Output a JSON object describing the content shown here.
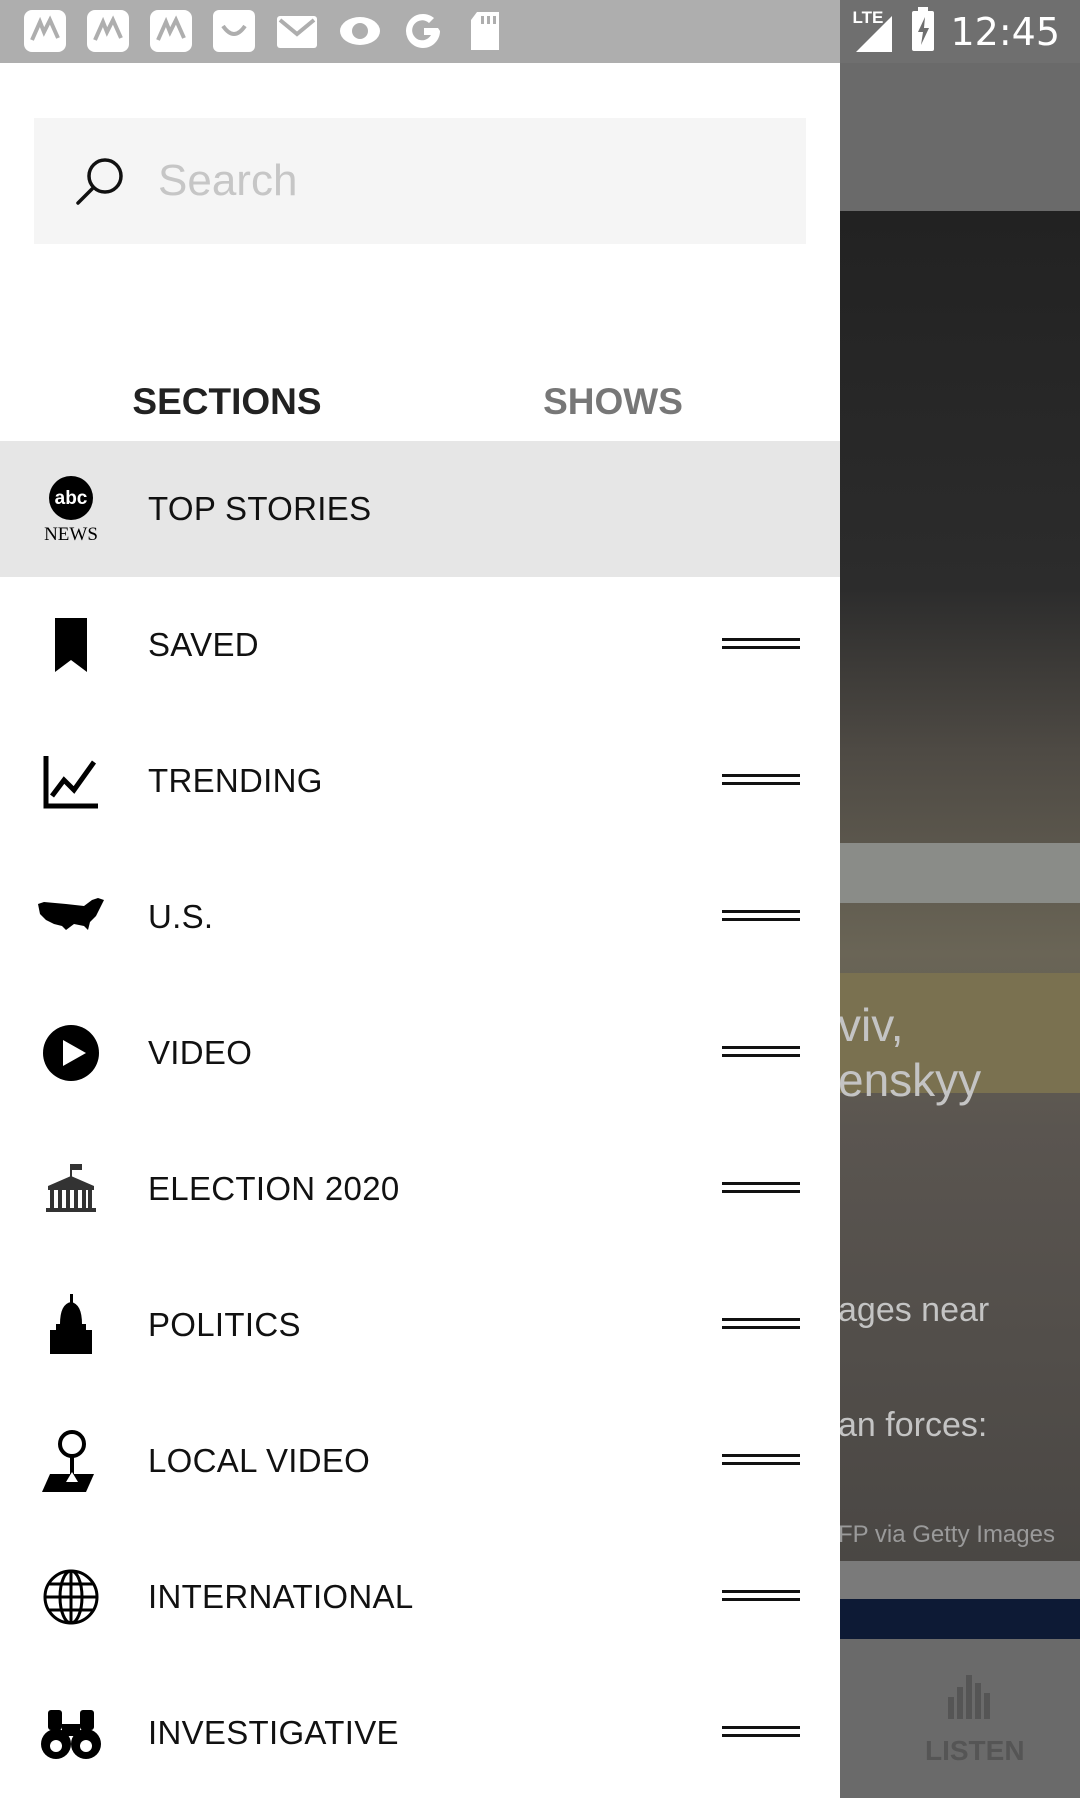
{
  "status_bar": {
    "network": "LTE",
    "time": "12:45"
  },
  "search": {
    "placeholder": "Search",
    "value": ""
  },
  "tabs": [
    {
      "label": "SECTIONS",
      "active": true
    },
    {
      "label": "SHOWS",
      "active": false
    }
  ],
  "sections": [
    {
      "label": "TOP STORIES",
      "icon": "abc-news-logo",
      "selected": true
    },
    {
      "label": "SAVED",
      "icon": "bookmark-icon"
    },
    {
      "label": "TRENDING",
      "icon": "trending-chart-icon"
    },
    {
      "label": "U.S.",
      "icon": "us-map-icon"
    },
    {
      "label": "VIDEO",
      "icon": "play-icon"
    },
    {
      "label": "ELECTION 2020",
      "icon": "capitol-building-icon"
    },
    {
      "label": "POLITICS",
      "icon": "dome-icon"
    },
    {
      "label": "LOCAL VIDEO",
      "icon": "map-pin-icon"
    },
    {
      "label": "INTERNATIONAL",
      "icon": "globe-icon"
    },
    {
      "label": "INVESTIGATIVE",
      "icon": "binoculars-icon"
    }
  ],
  "logo_text": {
    "abc": "abc",
    "news": "NEWS"
  },
  "background": {
    "headline_line1": "viv,",
    "headline_line2": "enskyy",
    "sub_line1": "ages near",
    "sub_line2": "an forces:",
    "credit": "FP via Getty Images",
    "listen_label": "LISTEN"
  },
  "colors": {
    "accent": "#1a8f86",
    "selected_row": "#e6e6e6",
    "status_bar": "#aeaeae"
  }
}
